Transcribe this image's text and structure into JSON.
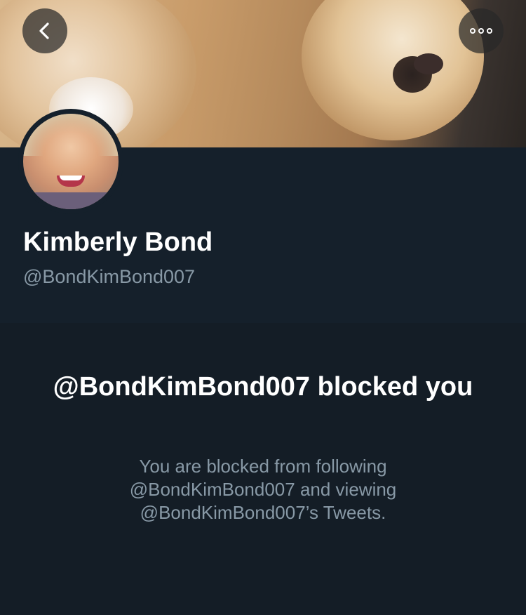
{
  "header": {
    "back_icon": "chevron-left-icon",
    "more_icon": "more-horizontal-icon"
  },
  "profile": {
    "name": "Kimberly Bond",
    "handle": "@BondKimBond007"
  },
  "blocked": {
    "title": "@BondKimBond007 blocked you",
    "description": "You are blocked from following @BondKimBond007 and viewing @BondKimBond007’s Tweets."
  },
  "colors": {
    "background": "#141d26",
    "profile_background": "#15202b",
    "primary_text": "#ffffff",
    "secondary_text": "#8899a6"
  }
}
